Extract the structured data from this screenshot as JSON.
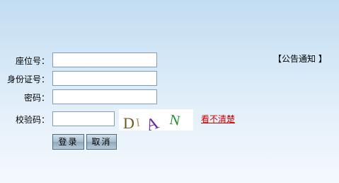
{
  "form": {
    "seat_label": "座位号：",
    "seat_value": "",
    "id_label": "身份证号：",
    "id_value": "",
    "password_label": "密码：",
    "password_value": "",
    "captcha_label": "校验码：",
    "captcha_value": "",
    "captcha_text": "DIAN",
    "refresh_captcha_link": "看不清楚",
    "login_button": "登录",
    "cancel_button": "取消"
  },
  "notice": {
    "link_text": "【公告通知 】"
  },
  "colors": {
    "link_red": "#cc0000",
    "field_border": "#7f9db9",
    "background_top": "#c2ddf1",
    "background_bottom": "#f4f9fd"
  }
}
